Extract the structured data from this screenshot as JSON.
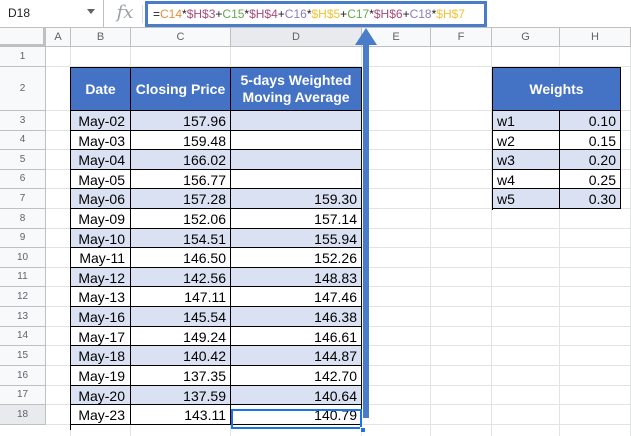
{
  "name_box": "D18",
  "formula": [
    {
      "t": "=",
      "c": "#202124"
    },
    {
      "t": "C14",
      "c": "#e69138"
    },
    {
      "t": "*",
      "c": "#202124"
    },
    {
      "t": "$H$3",
      "c": "#a64d79"
    },
    {
      "t": "+",
      "c": "#202124"
    },
    {
      "t": "C15",
      "c": "#6aa84f"
    },
    {
      "t": "*",
      "c": "#202124"
    },
    {
      "t": "$H$4",
      "c": "#a64d79"
    },
    {
      "t": "+",
      "c": "#202124"
    },
    {
      "t": "C16",
      "c": "#8e7cc3"
    },
    {
      "t": "*",
      "c": "#202124"
    },
    {
      "t": "$H$5",
      "c": "#f1c232"
    },
    {
      "t": "+",
      "c": "#202124"
    },
    {
      "t": "C17",
      "c": "#6aa84f"
    },
    {
      "t": "*",
      "c": "#202124"
    },
    {
      "t": "$H$6",
      "c": "#a64d79"
    },
    {
      "t": "+",
      "c": "#202124"
    },
    {
      "t": "C18",
      "c": "#8e7cc3"
    },
    {
      "t": "*",
      "c": "#202124"
    },
    {
      "t": "$H$7",
      "c": "#f1c232"
    }
  ],
  "fx_icon": "fx",
  "columns": [
    "A",
    "B",
    "C",
    "D",
    "E",
    "F",
    "G",
    "H"
  ],
  "rows": [
    "1",
    "2",
    "3",
    "4",
    "5",
    "6",
    "7",
    "8",
    "9",
    "10",
    "11",
    "12",
    "13",
    "14",
    "15",
    "16",
    "17",
    "18"
  ],
  "main_table": {
    "headers": {
      "date": "Date",
      "price": "Closing Price",
      "wma_line1": "5-days Weighted",
      "wma_line2": "Moving Average"
    },
    "rows": [
      {
        "date": "May-02",
        "price": "157.96",
        "wma": ""
      },
      {
        "date": "May-03",
        "price": "159.48",
        "wma": ""
      },
      {
        "date": "May-04",
        "price": "166.02",
        "wma": ""
      },
      {
        "date": "May-05",
        "price": "156.77",
        "wma": ""
      },
      {
        "date": "May-06",
        "price": "157.28",
        "wma": "159.30"
      },
      {
        "date": "May-09",
        "price": "152.06",
        "wma": "157.14"
      },
      {
        "date": "May-10",
        "price": "154.51",
        "wma": "155.94"
      },
      {
        "date": "May-11",
        "price": "146.50",
        "wma": "152.26"
      },
      {
        "date": "May-12",
        "price": "142.56",
        "wma": "148.83"
      },
      {
        "date": "May-13",
        "price": "147.11",
        "wma": "147.46"
      },
      {
        "date": "May-16",
        "price": "145.54",
        "wma": "146.38"
      },
      {
        "date": "May-17",
        "price": "149.24",
        "wma": "146.61"
      },
      {
        "date": "May-18",
        "price": "140.42",
        "wma": "144.87"
      },
      {
        "date": "May-19",
        "price": "137.35",
        "wma": "142.70"
      },
      {
        "date": "May-20",
        "price": "137.59",
        "wma": "140.64"
      },
      {
        "date": "May-23",
        "price": "143.11",
        "wma": "140.79"
      }
    ]
  },
  "weights_table": {
    "header": "Weights",
    "rows": [
      {
        "name": "w1",
        "value": "0.10"
      },
      {
        "name": "w2",
        "value": "0.15"
      },
      {
        "name": "w3",
        "value": "0.20"
      },
      {
        "name": "w4",
        "value": "0.25"
      },
      {
        "name": "w5",
        "value": "0.30"
      }
    ]
  },
  "colors": {
    "header_blue": "#4472c4",
    "band": "#d9e1f2",
    "highlight": "#4a7dc9",
    "selection": "#1a73e8"
  }
}
